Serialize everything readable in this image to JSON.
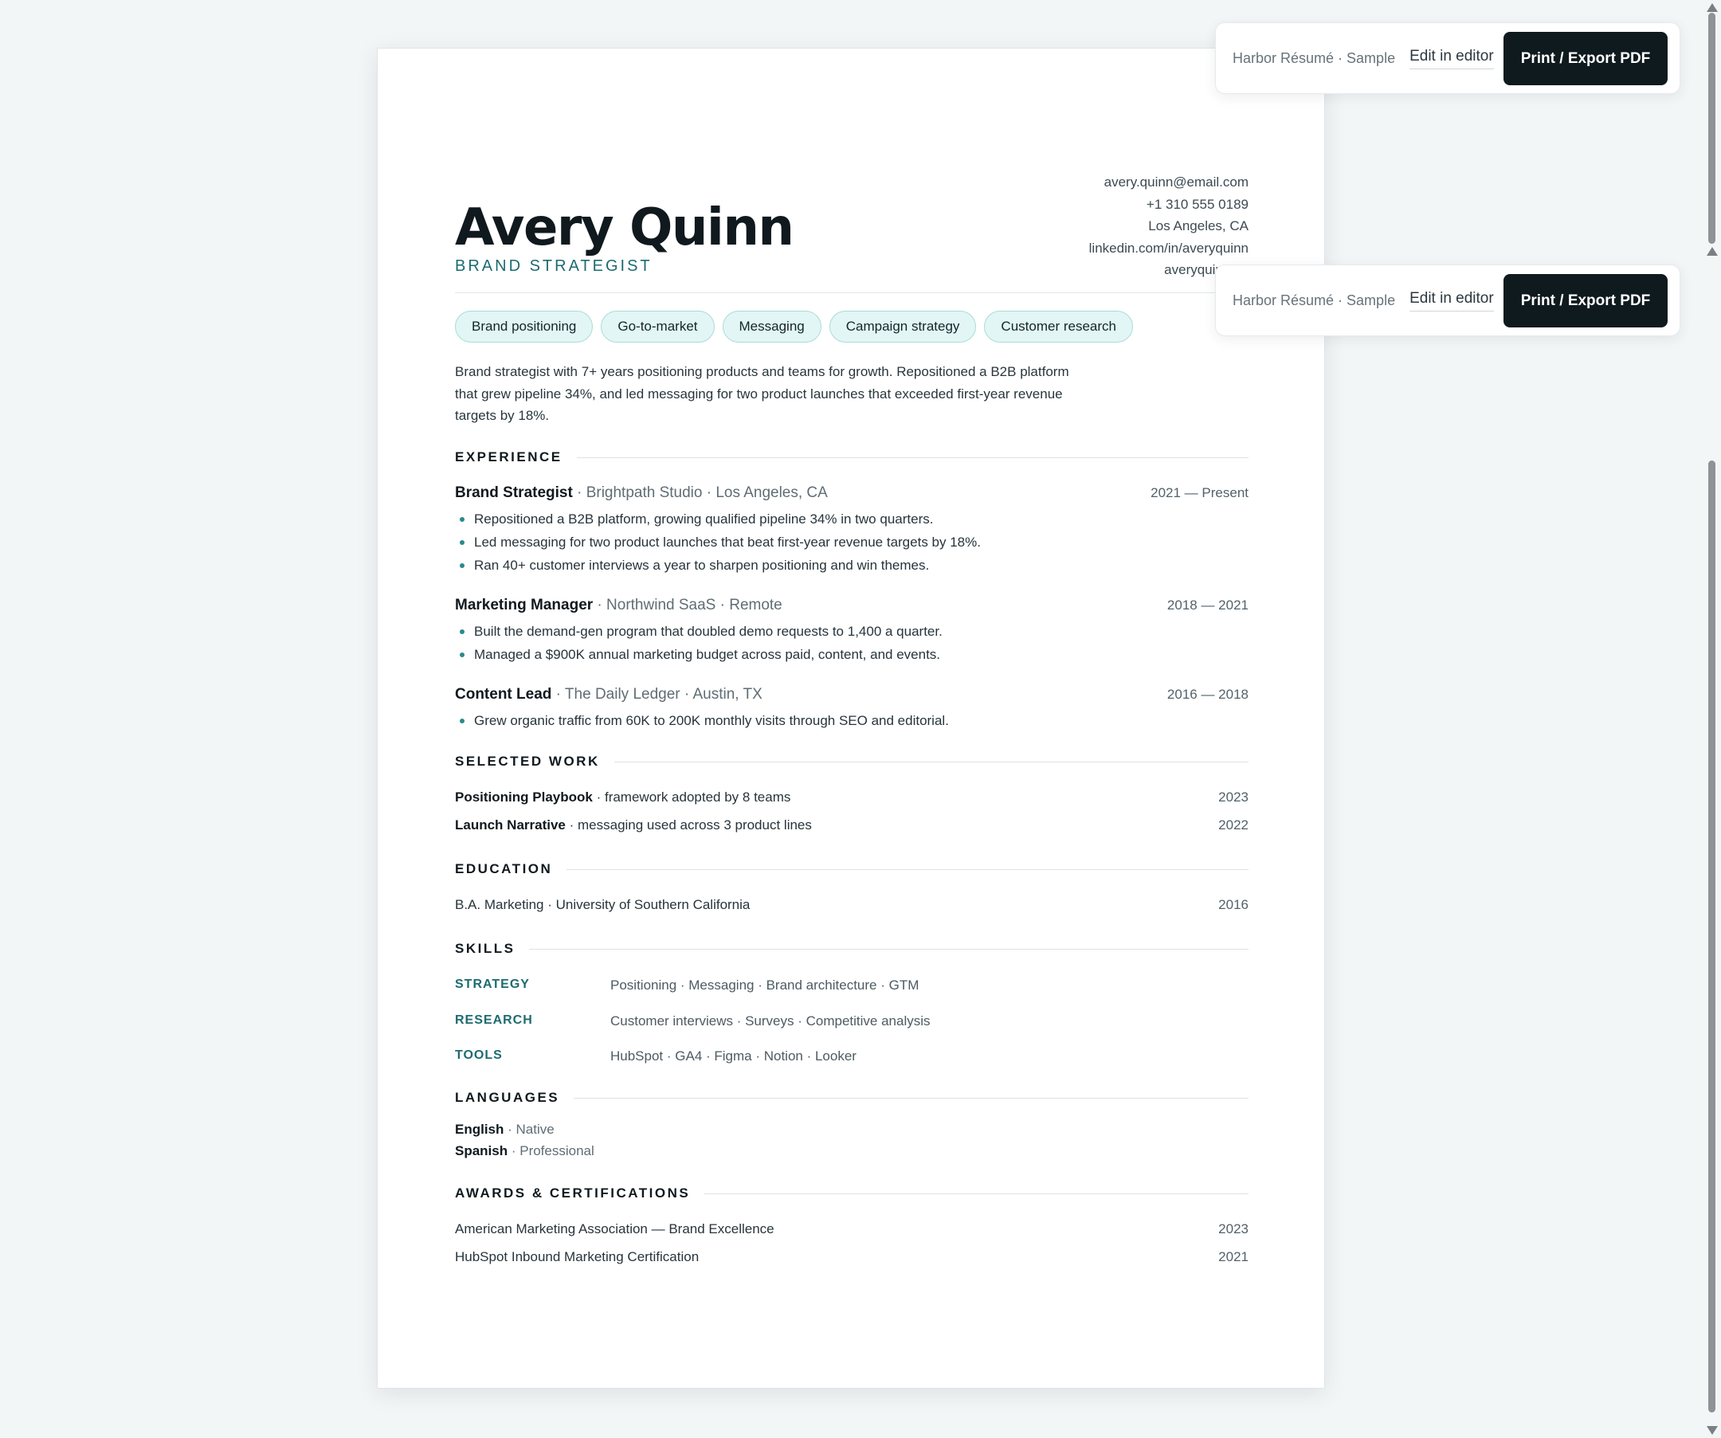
{
  "resume": {
    "name": "Avery Quinn",
    "role": "BRAND STRATEGIST",
    "contact": [
      "avery.quinn@email.com",
      "+1 310 555 0189",
      "Los Angeles, CA",
      "linkedin.com/in/averyquinn",
      "averyquinn.co"
    ],
    "tags": [
      "Brand positioning",
      "Go-to-market",
      "Messaging",
      "Campaign strategy",
      "Customer research"
    ],
    "summary": "Brand strategist with 7+ years positioning products and teams for growth. Repositioned a B2B platform that grew pipeline 34%, and led messaging for two product launches that exceeded first-year revenue targets by 18%.",
    "sections": {
      "experience": "EXPERIENCE",
      "selected_work": "SELECTED WORK",
      "education": "EDUCATION",
      "skills": "SKILLS",
      "languages": "LANGUAGES",
      "awards": "AWARDS & CERTIFICATIONS"
    },
    "experience": [
      {
        "title": "Brand Strategist",
        "sub": " · Brightpath Studio · Los Angeles, CA",
        "dates": "2021 — Present",
        "bullets": [
          "Repositioned a B2B platform, growing qualified pipeline 34% in two quarters.",
          "Led messaging for two product launches that beat first-year revenue targets by 18%.",
          "Ran 40+ customer interviews a year to sharpen positioning and win themes."
        ]
      },
      {
        "title": "Marketing Manager",
        "sub": " · Northwind SaaS · Remote",
        "dates": "2018 — 2021",
        "bullets": [
          "Built the demand-gen program that doubled demo requests to 1,400 a quarter.",
          "Managed a $900K annual marketing budget across paid, content, and events."
        ]
      },
      {
        "title": "Content Lead",
        "sub": " · The Daily Ledger · Austin, TX",
        "dates": "2016 — 2018",
        "bullets": [
          "Grew organic traffic from 60K to 200K monthly visits through SEO and editorial."
        ]
      }
    ],
    "selected_work": [
      {
        "name": "Positioning Playbook",
        "desc": " · framework adopted by 8 teams",
        "year": "2023"
      },
      {
        "name": "Launch Narrative",
        "desc": " · messaging used across 3 product lines",
        "year": "2022"
      }
    ],
    "education": {
      "text": "B.A. Marketing · University of Southern California",
      "year": "2016"
    },
    "skills": [
      {
        "category": "STRATEGY",
        "items": "Positioning · Messaging · Brand architecture · GTM"
      },
      {
        "category": "RESEARCH",
        "items": "Customer interviews · Surveys · Competitive analysis"
      },
      {
        "category": "TOOLS",
        "items": "HubSpot · GA4 · Figma · Notion · Looker"
      }
    ],
    "languages": [
      {
        "language": "English",
        "level": " · Native"
      },
      {
        "language": "Spanish",
        "level": " · Professional"
      }
    ],
    "awards": [
      {
        "name": "American Marketing Association — Brand Excellence",
        "year": "2023"
      },
      {
        "name": "HubSpot Inbound Marketing Certification",
        "year": "2021"
      }
    ]
  },
  "toolbar": {
    "brand": "Harbor Résumé · Sample",
    "edit_label": "Edit in editor",
    "print_label": "Print / Export PDF"
  },
  "colors": {
    "accent": "#1d6b70",
    "tag_bg": "#e2f6f5",
    "button_bg": "#0f1a1e",
    "page_bg": "#f3f6f7"
  }
}
